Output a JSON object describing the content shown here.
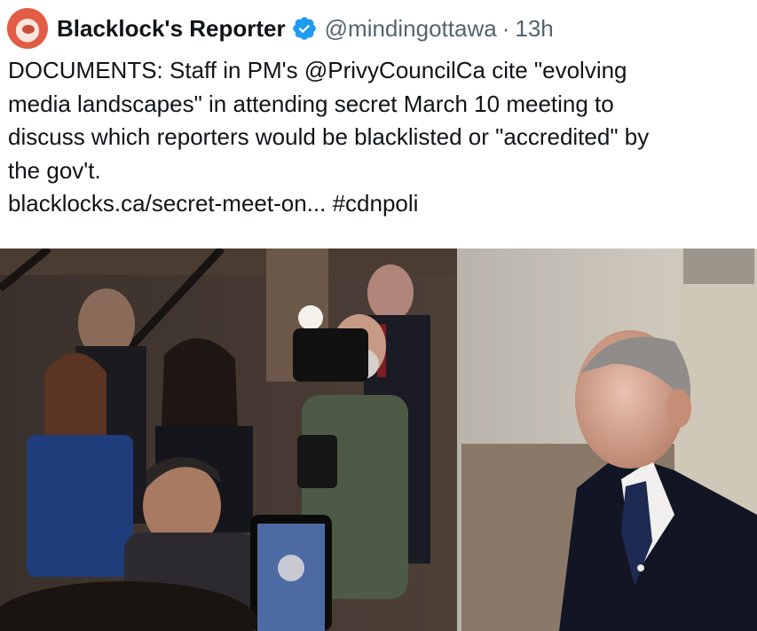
{
  "tweet": {
    "display_name": "Blacklock's Reporter",
    "handle": "@mindingottawa",
    "separator": "·",
    "time": "13h",
    "verified_color": "#1d9bf0",
    "text_lines": [
      "DOCUMENTS: Staff in PM's @PrivyCouncilCa cite \"evolving",
      "media landscapes\" in attending secret March 10 meeting to",
      "discuss which reporters would be blacklisted or \"accredited\" by",
      "the gov't.",
      "blacklocks.ca/secret-meet-on... #cdnpoli"
    ],
    "media": {
      "alt_icon": "photo-of-press-scrum"
    }
  }
}
